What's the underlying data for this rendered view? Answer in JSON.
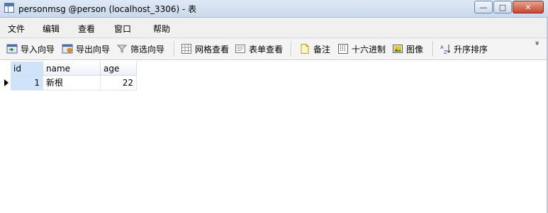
{
  "window": {
    "title": "personmsg @person (localhost_3306) - 表",
    "buttons": {
      "minimize": "—",
      "maximize": "□",
      "close": "✕"
    }
  },
  "menu": {
    "items": [
      {
        "label": "文件"
      },
      {
        "label": "编辑"
      },
      {
        "label": "查看"
      },
      {
        "label": "窗口"
      },
      {
        "label": "帮助"
      }
    ]
  },
  "toolbar": {
    "import_wizard": "导入向导",
    "export_wizard": "导出向导",
    "filter_wizard": "筛选向导",
    "grid_view": "网格查看",
    "form_view": "表单查看",
    "memo": "备注",
    "hex": "十六进制",
    "image": "图像",
    "sort_asc": "升序排序",
    "overflow": "»"
  },
  "grid": {
    "columns": [
      {
        "label": "id"
      },
      {
        "label": "name"
      },
      {
        "label": "age"
      }
    ],
    "rows": [
      {
        "id": "1",
        "name": "新根",
        "age": "22"
      }
    ]
  },
  "colors": {
    "selection": "#cfe4fa",
    "titlebar": "#dfe9f5",
    "close_button": "#c7462b"
  }
}
